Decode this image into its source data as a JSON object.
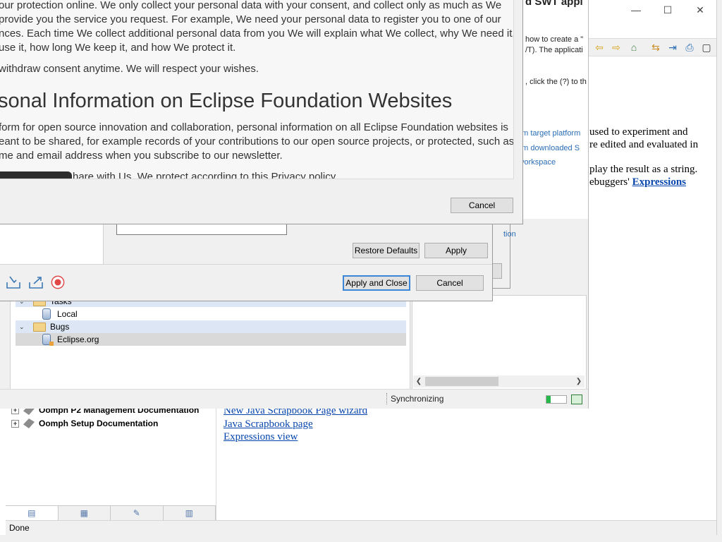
{
  "help_window": {
    "toc_items": [
      {
        "label": "Oomph P2 Management Documentation"
      },
      {
        "label": "Oomph Setup Documentation"
      }
    ],
    "links": [
      {
        "label": "New Java Scrapbook Page wizard"
      },
      {
        "label": "Java Scrapbook page"
      },
      {
        "label": "Expressions view"
      }
    ],
    "article": {
      "line1a": "used to experiment and",
      "line1b": "re edited and evaluated in",
      "line2a": "play the result as a string.",
      "line2b_prefix": "ebuggers'",
      "line2b_link": "Expressions"
    },
    "status": "Done",
    "toc_tabs": [
      "contents-icon",
      "index-icon",
      "search-icon",
      "bookmarks-icon"
    ]
  },
  "welcome": {
    "title": "d SWT appl",
    "line1": "how to create a \"",
    "line2": "/T). The applicati",
    "line3": ", click the (?) to th",
    "links": [
      "om target platform",
      "om downloaded S",
      "vorkspace"
    ]
  },
  "eclipse": {
    "tasks": {
      "categories": [
        {
          "label": "Tasks",
          "children": [
            {
              "label": "Local"
            }
          ]
        },
        {
          "label": "Bugs",
          "children": [
            {
              "label": "Eclipse.org"
            }
          ]
        }
      ]
    },
    "status": {
      "sync_label": "Synchronizing",
      "progress": 0.2
    }
  },
  "prefs_dialog": {
    "restore_defaults": "Restore Defaults",
    "apply": "Apply",
    "apply_and_close": "Apply and Close",
    "cancel": "Cancel"
  },
  "back_dialog": {
    "link": "tion"
  },
  "privacy_dialog": {
    "paragraphs": [
      "our protection online. We only collect your personal data with your consent, and collect only as much as We",
      "provide you the service you request. For example, We need your personal data to register you to one of our",
      "nces. Each time We collect additional personal data from you We will explain what We collect, why We need it,",
      "use it, how long We keep it, and how We protect it."
    ],
    "withdraw": "withdraw consent anytime. We will respect your wishes.",
    "heading": "sonal Information on Eclipse Foundation Websites",
    "paragraph2": [
      "form for open source innovation and collaboration, personal information on all Eclipse Foundation websites is",
      "eant to be shared, for example records of your contributions to our open source projects, or protected, such as",
      "me and email address when you subscribe to our newsletter."
    ],
    "cut_line": "hare with Us. We protect according to this Privacy policy.",
    "cancel": "Cancel"
  },
  "colors": {
    "link": "#0645ad",
    "eclipse_link": "#2a6db5",
    "default_button_border": "#3b86d8",
    "progress": "#25b84a"
  }
}
